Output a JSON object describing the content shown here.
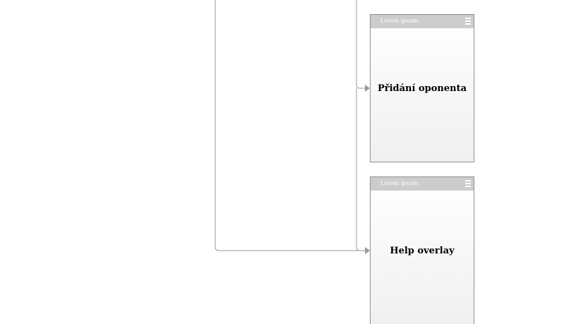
{
  "screens": [
    {
      "bar_title": "Lorem ipsum",
      "menu_icon": "hamburger-icon",
      "label": "Přidání oponenta"
    },
    {
      "bar_title": "Lorem ipsum",
      "menu_icon": "hamburger-icon",
      "label": "Help overlay"
    }
  ],
  "colors": {
    "connector": "#999999",
    "screen_border": "#8f8f8f",
    "header_bar": "#cccccc"
  }
}
